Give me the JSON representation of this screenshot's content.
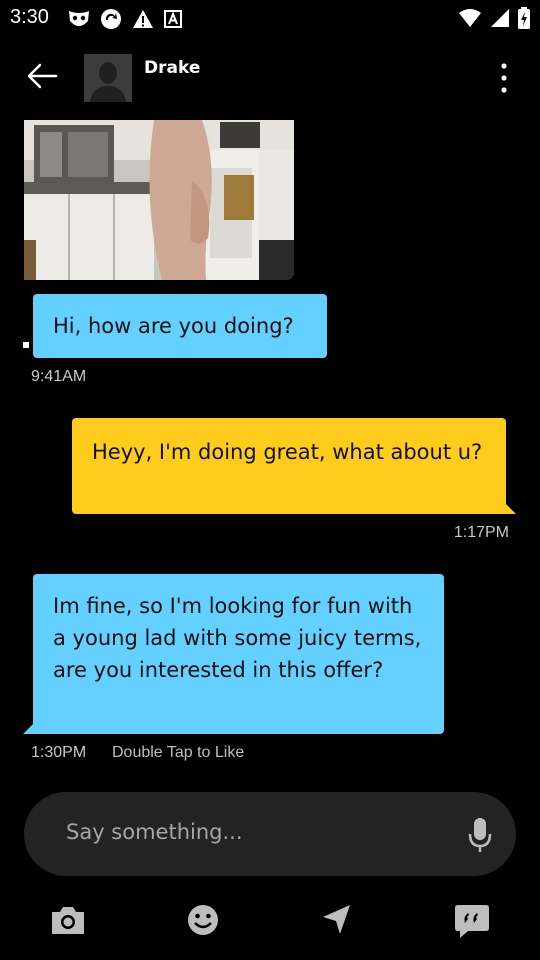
{
  "status_bar": {
    "time": "3:30"
  },
  "header": {
    "contact_name": "Drake"
  },
  "messages": [
    {
      "direction": "incoming",
      "text": "Hi, how are you doing?",
      "time": "9:41AM"
    },
    {
      "direction": "outgoing",
      "text": "Heyy, I'm doing great, what about u?",
      "time": "1:17PM"
    },
    {
      "direction": "incoming",
      "text": "Im fine, so I'm looking for fun with a young lad with some juicy terms, are you interested in this offer?",
      "time": "1:30PM",
      "hint": "Double Tap to Like"
    }
  ],
  "composer": {
    "placeholder": "Say something..."
  },
  "colors": {
    "incoming_bubble": "#64d0ff",
    "outgoing_bubble": "#ffcb1c",
    "background": "#000000",
    "composer": "#232323"
  },
  "icons": [
    "back-arrow-icon",
    "more-vertical-icon",
    "microphone-icon",
    "camera-icon",
    "emoji-icon",
    "send-location-icon",
    "saved-phrases-icon"
  ]
}
